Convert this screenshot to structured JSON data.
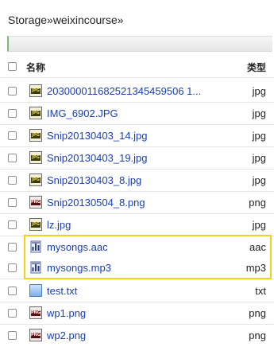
{
  "breadcrumb": "Storage»weixincourse»",
  "header": {
    "name_label": "名称",
    "type_label": "类型"
  },
  "files": [
    {
      "name": "203000011682521345459506 1...",
      "type": "jpg",
      "icon": "jpg-file-icon"
    },
    {
      "name": "IMG_6902.JPG",
      "type": "jpg",
      "icon": "jpg-file-icon"
    },
    {
      "name": "Snip20130403_14.jpg",
      "type": "jpg",
      "icon": "jpg-file-icon"
    },
    {
      "name": "Snip20130403_19.jpg",
      "type": "jpg",
      "icon": "jpg-file-icon"
    },
    {
      "name": "Snip20130403_8.jpg",
      "type": "jpg",
      "icon": "jpg-file-icon"
    },
    {
      "name": "Snip20130504_8.png",
      "type": "png",
      "icon": "png-file-icon"
    },
    {
      "name": "lz.jpg",
      "type": "jpg",
      "icon": "jpg-file-icon"
    },
    {
      "name": "mysongs.aac",
      "type": "aac",
      "icon": "audio-file-icon"
    },
    {
      "name": "mysongs.mp3",
      "type": "mp3",
      "icon": "audio-file-icon"
    },
    {
      "name": "test.txt",
      "type": "txt",
      "icon": "text-file-icon"
    },
    {
      "name": "wp1.png",
      "type": "png",
      "icon": "png-file-icon"
    },
    {
      "name": "wp2.png",
      "type": "png",
      "icon": "png-file-icon"
    }
  ]
}
